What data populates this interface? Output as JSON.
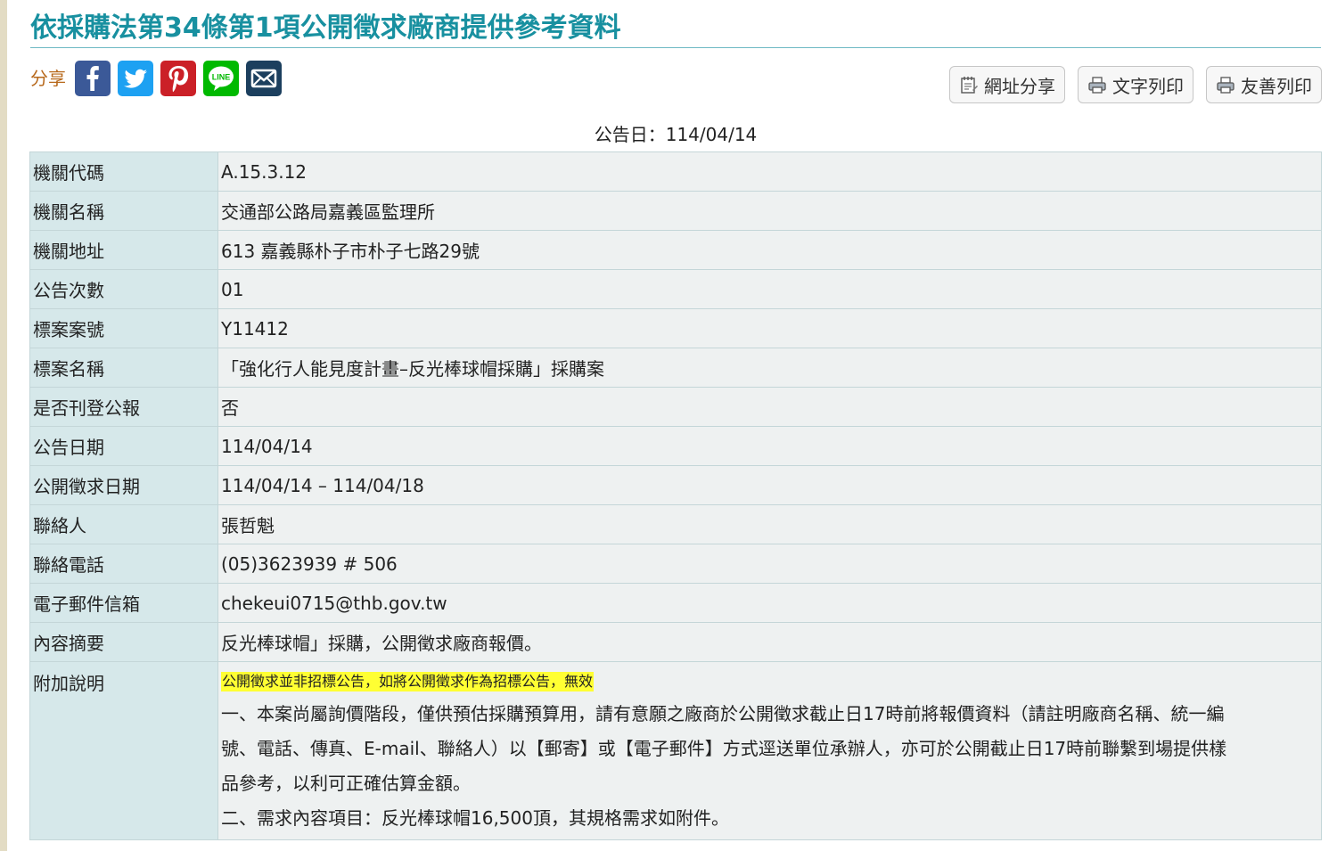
{
  "page_title": "依採購法第34條第1項公開徵求廠商提供參考資料",
  "share": {
    "label": "分享",
    "icons": [
      "facebook-icon",
      "twitter-icon",
      "pinterest-icon",
      "line-icon",
      "mail-icon"
    ],
    "colors": {
      "facebook": "#3b5998",
      "twitter": "#1da1f2",
      "pinterest": "#cb2027",
      "line": "#00b900",
      "mail": "#1c3f5e"
    },
    "line_text": "LINE"
  },
  "tools": {
    "url_share": "網址分享",
    "text_print": "文字列印",
    "friendly_print": "友善列印"
  },
  "announce_date": "公告日：114/04/14",
  "rows": [
    {
      "key": "機關代碼",
      "value": "A.15.3.12"
    },
    {
      "key": "機關名稱",
      "value": "交通部公路局嘉義區監理所"
    },
    {
      "key": "機關地址",
      "value": "613 嘉義縣朴子市朴子七路29號"
    },
    {
      "key": "公告次數",
      "value": "01"
    },
    {
      "key": "標案案號",
      "value": "Y11412"
    },
    {
      "key": "標案名稱",
      "value": "「強化行人能見度計畫–反光棒球帽採購」採購案"
    },
    {
      "key": "是否刊登公報",
      "value": "否"
    },
    {
      "key": "公告日期",
      "value": "114/04/14"
    },
    {
      "key": "公開徵求日期",
      "value": "114/04/14 – 114/04/18"
    },
    {
      "key": "聯絡人",
      "value": "張哲魁"
    },
    {
      "key": "聯絡電話",
      "value": "(05)3623939 # 506"
    },
    {
      "key": "電子郵件信箱",
      "value": "chekeui0715@thb.gov.tw"
    },
    {
      "key": "內容摘要",
      "value": "反光棒球帽」採購，公開徵求廠商報價。"
    }
  ],
  "notes": {
    "key": "附加說明",
    "highlight": "公開徵求並非招標公告，如將公開徵求作為招標公告，無效",
    "lines": [
      "一、本案尚屬詢價階段，僅供預估採購預算用，請有意願之廠商於公開徵求截止日17時前將報價資料（請註明廠商名稱、統一編",
      "號、電話、傳真、E-mail、聯絡人）以【郵寄】或【電子郵件】方式逕送單位承辦人，亦可於公開截止日17時前聯繫到場提供樣",
      "品參考，以利可正確估算金額。",
      "二、需求內容項目：反光棒球帽16,500頂，其規格需求如附件。"
    ]
  }
}
